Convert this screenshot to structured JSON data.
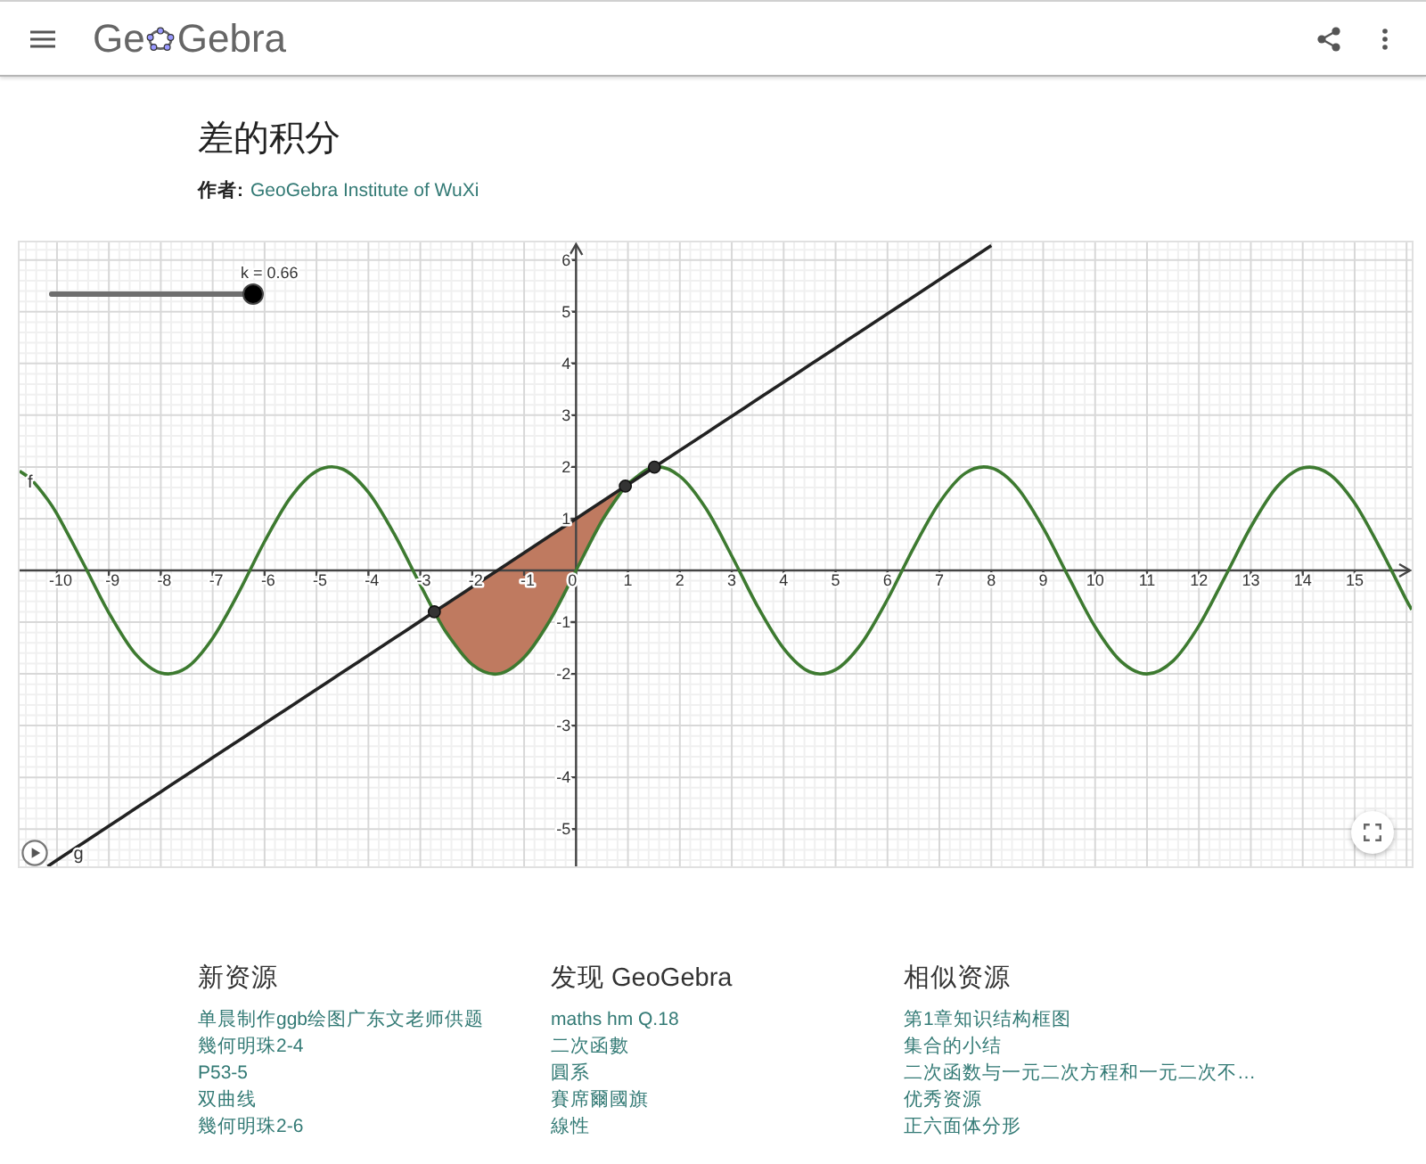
{
  "header": {
    "logo": {
      "before_icon": "Ge",
      "after_icon": "Gebra"
    }
  },
  "title": "差的积分",
  "author": {
    "label": "作者:",
    "name": "GeoGebra Institute of WuXi"
  },
  "applet": {
    "slider": {
      "label": "k = 0.66",
      "level": 1
    },
    "chart_data": {
      "type": "line",
      "x": [
        -10.72,
        -10.5,
        -10.18,
        -10,
        -9.5,
        -9,
        -8.5,
        -8,
        -7.5,
        -7,
        -6.5,
        -6,
        -5.5,
        -5,
        -4.5,
        -4,
        -3.5,
        -3,
        -2.73,
        -2.5,
        -2,
        -1.5,
        -1,
        -0.5,
        0,
        0.5,
        0.95,
        1,
        1.5,
        2,
        2.5,
        3,
        3.5,
        4,
        4.5,
        5,
        5.5,
        6,
        6.5,
        7,
        7.5,
        8,
        8.5,
        9,
        9.5,
        10,
        10.5,
        11,
        11.5,
        12,
        12.5,
        13,
        13.5,
        14,
        14.5,
        15,
        15.5,
        16,
        16.1
      ],
      "series": [
        {
          "name": "f",
          "color": "#3d7a30",
          "values": [
            1.92,
            1.76,
            1.37,
            1.09,
            0.15,
            -0.82,
            -1.6,
            -1.98,
            -1.88,
            -1.31,
            -0.43,
            0.56,
            1.41,
            1.92,
            1.96,
            1.51,
            0.7,
            -0.28,
            -0.8,
            -1.2,
            -1.82,
            -2.0,
            -1.68,
            -0.96,
            0,
            0.96,
            1.63,
            1.68,
            2.0,
            1.82,
            1.2,
            0.28,
            -0.7,
            -1.51,
            -1.96,
            -1.92,
            -1.41,
            -0.56,
            0.43,
            1.31,
            1.88,
            1.98,
            1.6,
            0.82,
            -0.15,
            -1.09,
            -1.76,
            -2.0,
            -1.75,
            -1.07,
            -0.13,
            0.84,
            1.61,
            1.98,
            1.87,
            1.3,
            0.41,
            -0.58,
            -0.76
          ]
        },
        {
          "name": "g",
          "color": "#222222",
          "values": [
            null,
            null,
            -5.72,
            -5.6,
            -5.27,
            -4.94,
            -4.61,
            -4.28,
            -3.95,
            -3.62,
            -3.29,
            -2.96,
            -2.63,
            -2.3,
            -1.97,
            -1.64,
            -1.31,
            -0.98,
            -0.8,
            -0.65,
            -0.32,
            0.01,
            0.34,
            0.67,
            1,
            1.33,
            1.63,
            1.66,
            1.99,
            2.32,
            2.65,
            2.98,
            3.31,
            3.64,
            3.97,
            4.3,
            4.63,
            4.96,
            5.29,
            5.62,
            5.95,
            6.28,
            null,
            null,
            null,
            null,
            null,
            null,
            null,
            null,
            null,
            null,
            null,
            null,
            null,
            null,
            null,
            null,
            null
          ]
        }
      ],
      "xlim": [
        -10.72,
        16.1
      ],
      "ylim": [
        -5.72,
        6.34
      ],
      "xticks": [
        -10,
        -9,
        -8,
        -7,
        -6,
        -5,
        -4,
        -3,
        -2,
        -1,
        0,
        1,
        2,
        3,
        4,
        5,
        6,
        7,
        8,
        9,
        10,
        11,
        12,
        13,
        14,
        15
      ],
      "yticks": [
        -5,
        -4,
        -3,
        -2,
        -1,
        1,
        2,
        3,
        4,
        5,
        6
      ],
      "grid": true
    }
  },
  "sections": [
    {
      "heading": "新资源",
      "links": [
        "单晨制作ggb绘图广东文老师供题",
        "幾何明珠2-4",
        "P53-5",
        "双曲线",
        "幾何明珠2-6"
      ]
    },
    {
      "heading": "发现 GeoGebra",
      "links": [
        "maths hm Q.18",
        "二次函數",
        "圓系",
        "賽席爾國旗",
        "線性"
      ]
    },
    {
      "heading": "相似资源",
      "links": [
        "第1章知识结构框图",
        "集合的小结",
        "二次函数与一元二次方程和一元二次不…",
        "优秀资源",
        "正六面体分形"
      ]
    }
  ]
}
